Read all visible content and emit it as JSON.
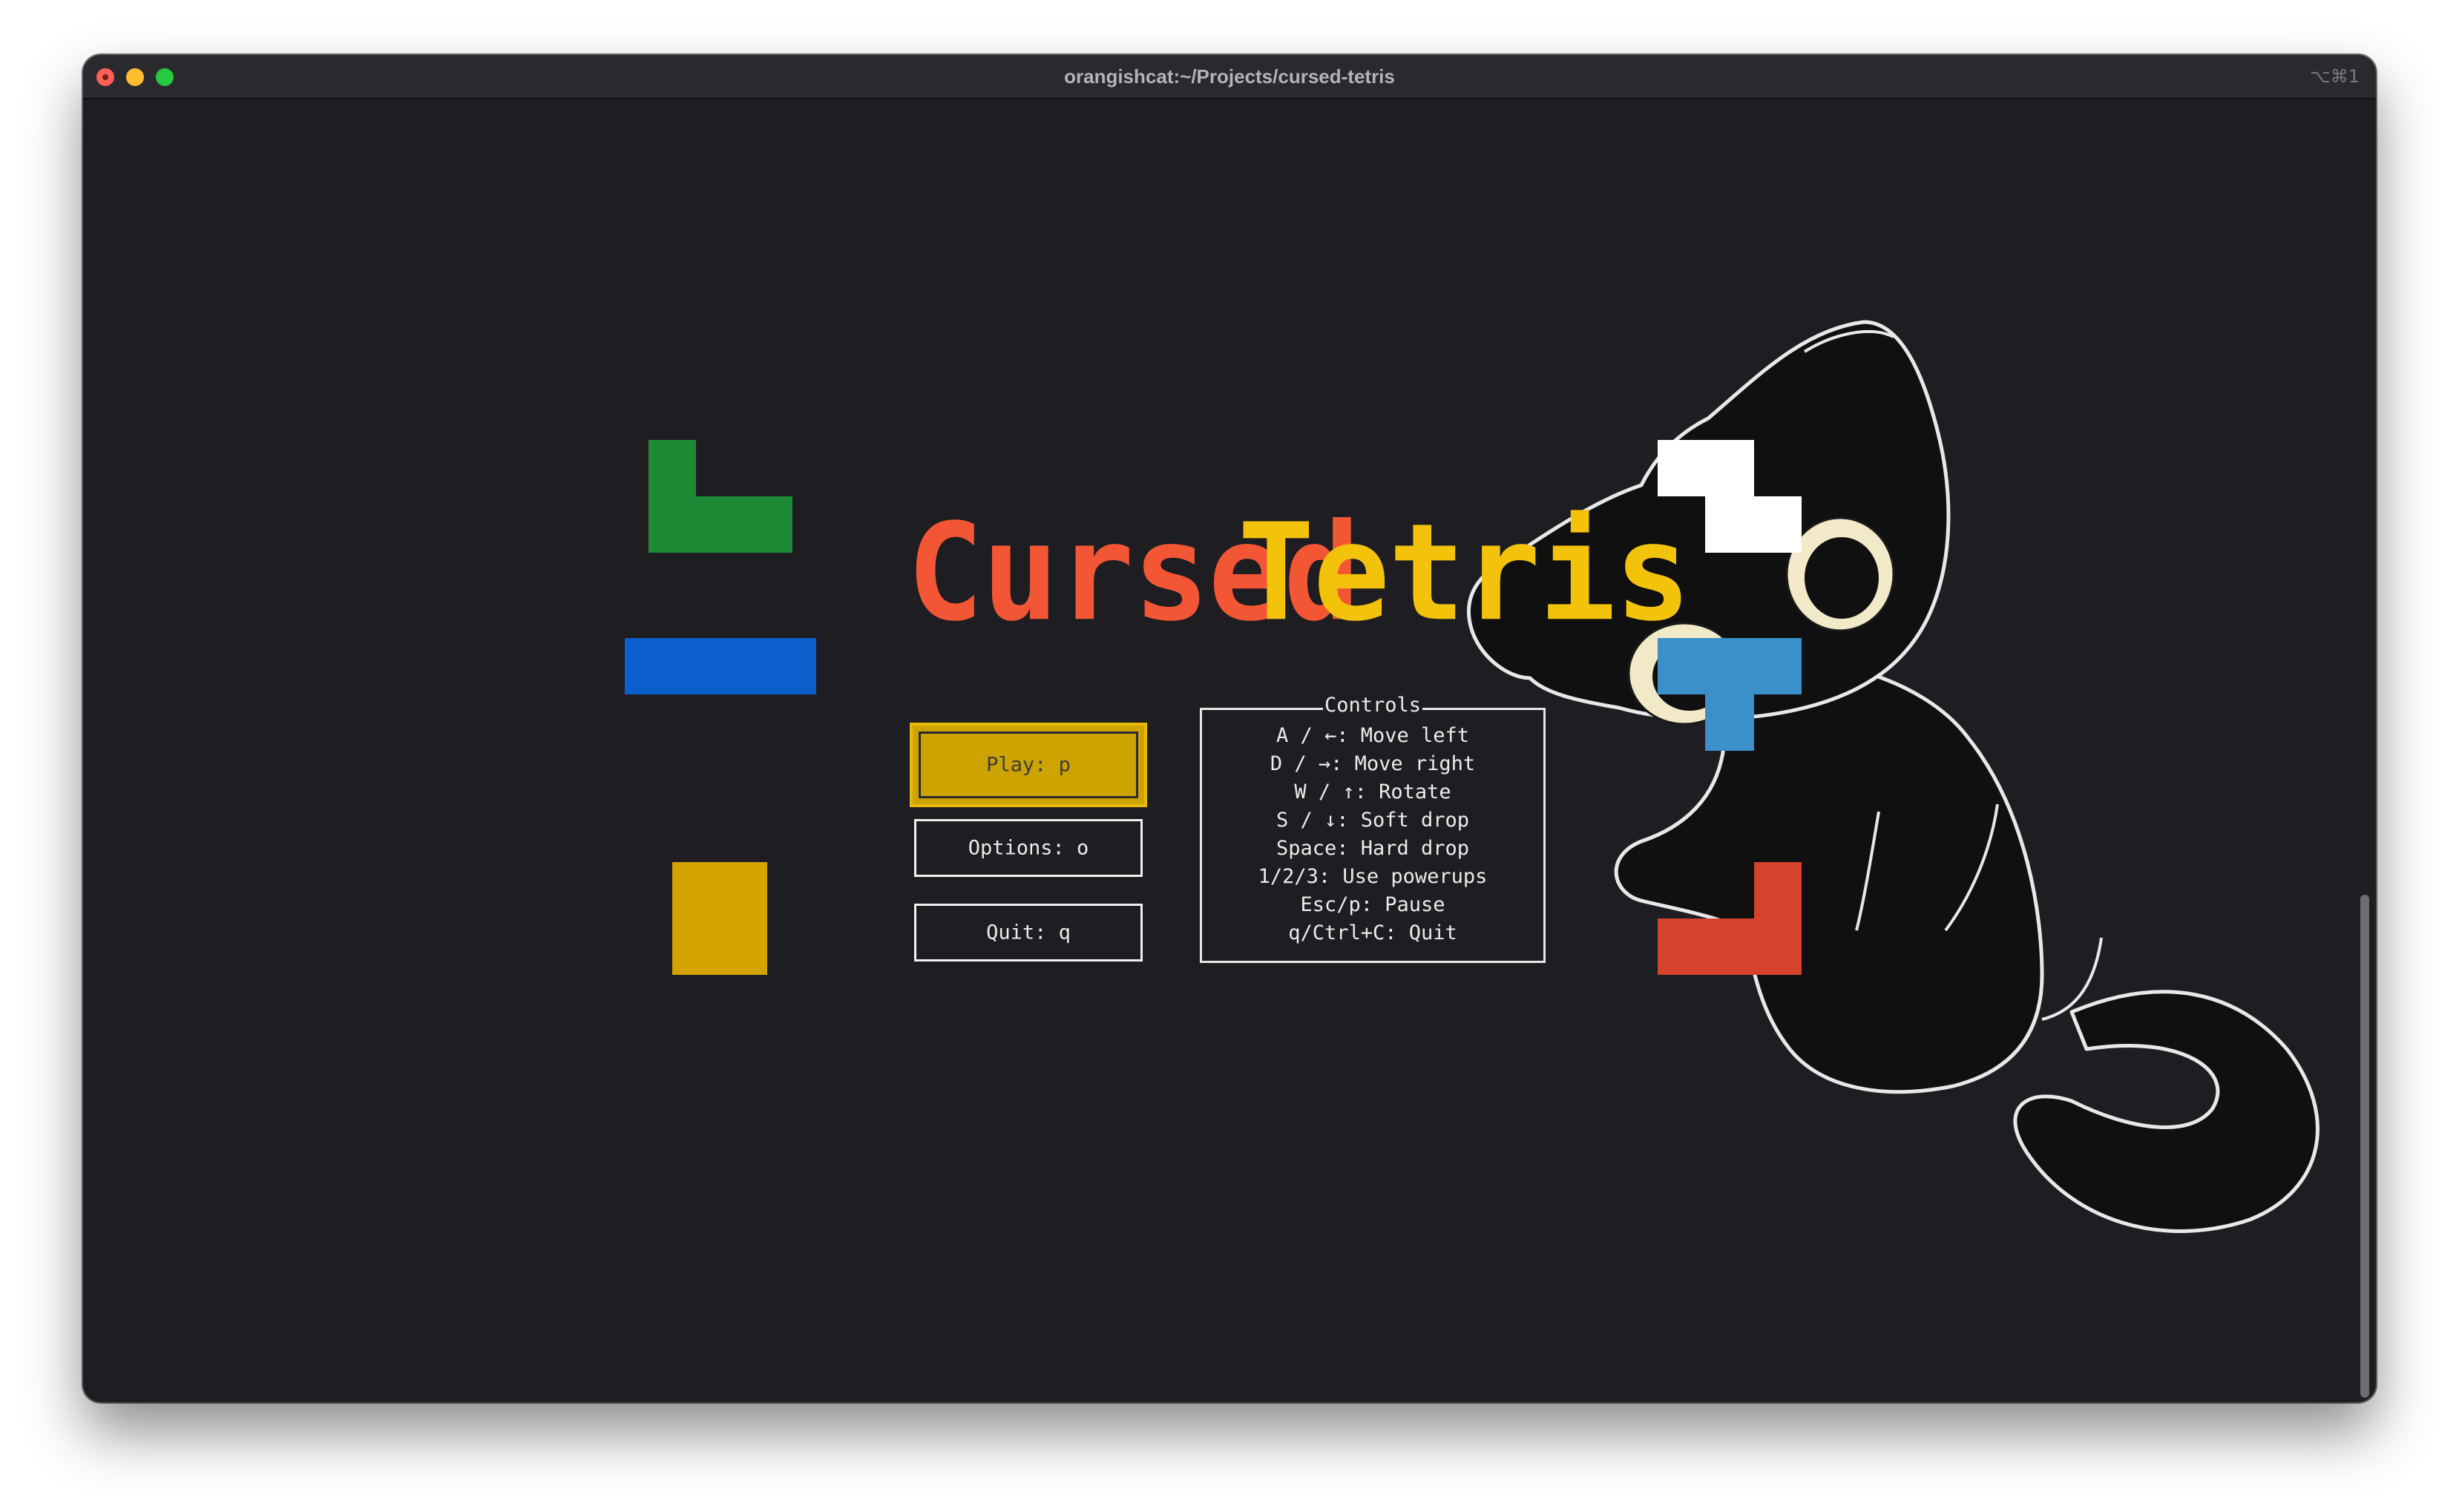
{
  "window": {
    "title": "orangishcat:~/Projects/cursed-tetris",
    "shortcut": "⌥⌘1",
    "background": "#1e1d21"
  },
  "game": {
    "title_word_1": "Cursed",
    "title_word_2": "Tetris",
    "title_color_1": "#f25634",
    "title_color_2": "#f3c20a"
  },
  "menu": {
    "play_label": "Play: p",
    "options_label": "Options: o",
    "quit_label": "Quit: q",
    "selected": "play",
    "selected_color": "#cda300"
  },
  "controls": {
    "title": "Controls",
    "items": [
      "A / ←: Move left",
      "D / →: Move right",
      "W / ↑: Rotate",
      "S / ↓: Soft drop",
      "Space: Hard drop",
      "1/2/3: Use powerups",
      "Esc/p: Pause",
      "q/Ctrl+C: Quit"
    ]
  },
  "pieces": {
    "left_top": {
      "shape": "J",
      "color": "#1f8a36"
    },
    "left_middle": {
      "shape": "I",
      "color": "#0a5fcc"
    },
    "left_bottom": {
      "shape": "O",
      "color": "#d3a300"
    },
    "right_top": {
      "shape": "Z",
      "color": "#ffffff"
    },
    "right_middle": {
      "shape": "T",
      "color": "#3b90c9"
    },
    "right_bottom": {
      "shape": "J",
      "color": "#d6432c"
    }
  },
  "icons": {
    "close": "close-icon",
    "minimize": "minimize-icon",
    "zoom": "zoom-icon",
    "mascot": "black-cat-illustration"
  }
}
